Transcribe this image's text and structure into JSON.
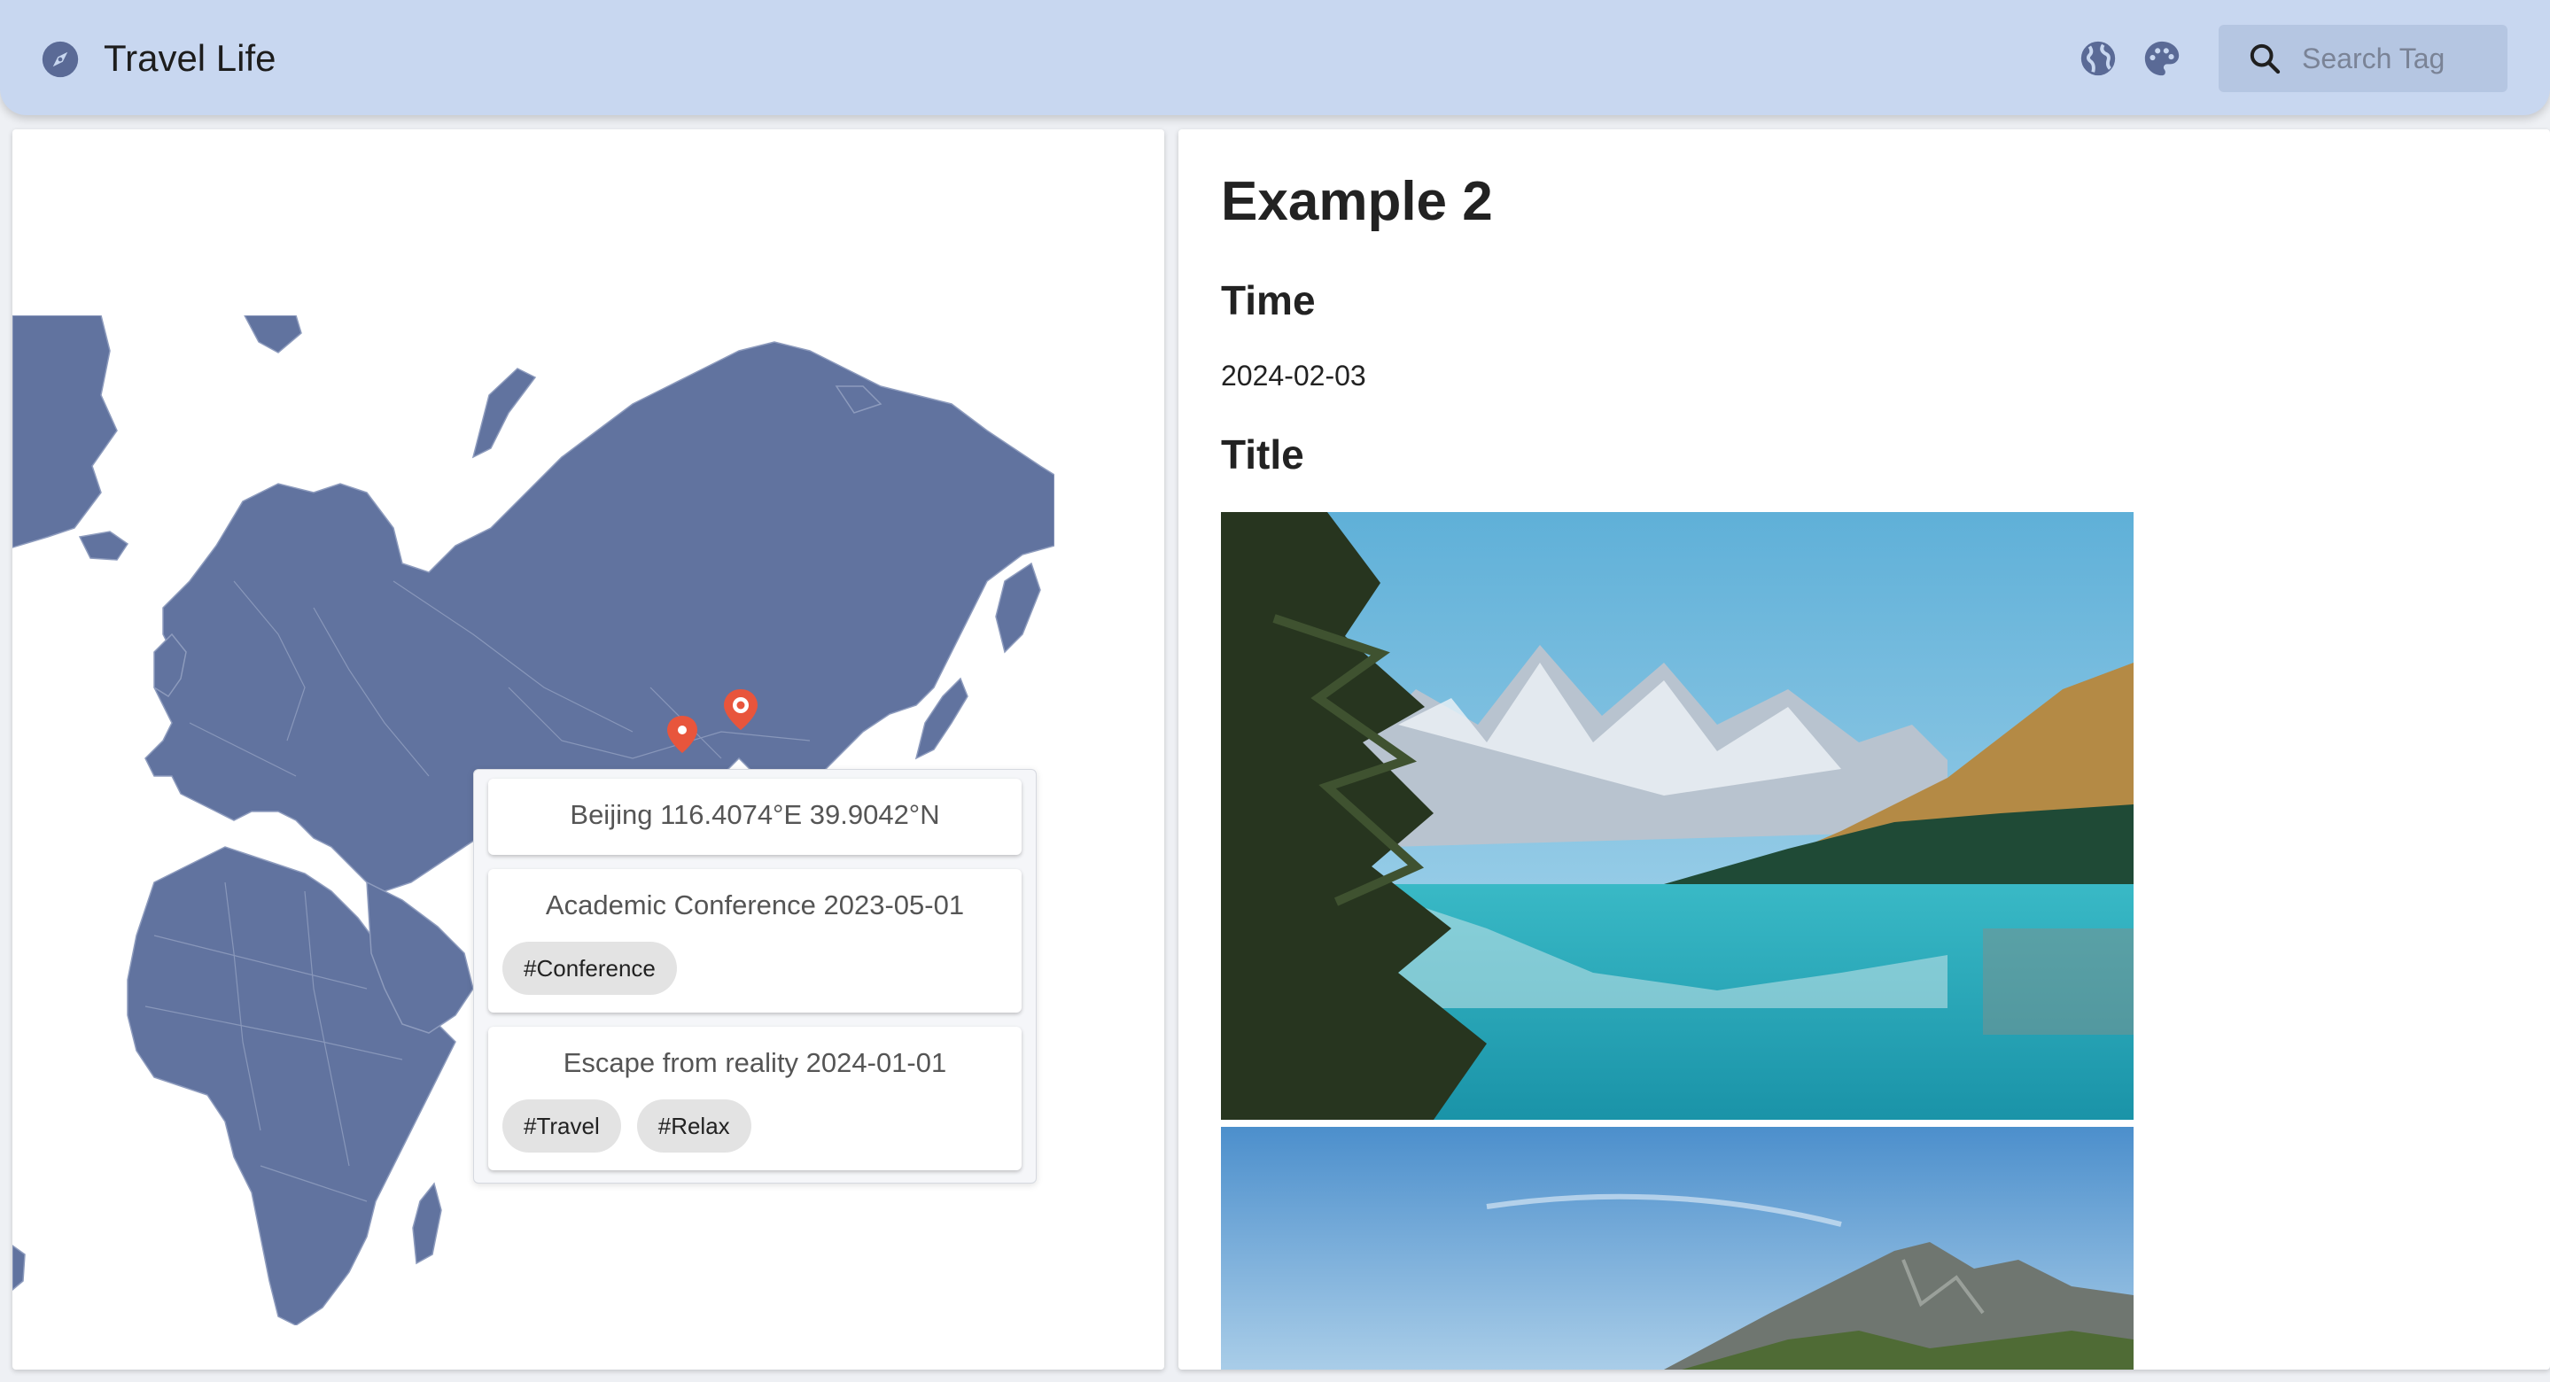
{
  "app": {
    "title": "Travel Life",
    "brand_icon": "compass-icon",
    "actions": [
      {
        "icon": "globe-icon"
      },
      {
        "icon": "palette-icon"
      }
    ],
    "search": {
      "placeholder": "Search Tag",
      "value": "",
      "icon": "search-icon"
    }
  },
  "map": {
    "land_color": "#61739f",
    "marker_color": "#e8553c",
    "markers": [
      {
        "type": "pin-filled"
      },
      {
        "type": "pin-outline"
      }
    ],
    "popup": {
      "location": "Beijing 116.4074°E 39.9042°N",
      "events": [
        {
          "title": "Academic Conference 2023-05-01",
          "tags": [
            "#Conference"
          ]
        },
        {
          "title": "Escape from reality 2024-01-01",
          "tags": [
            "#Travel",
            "#Relax"
          ]
        }
      ]
    }
  },
  "detail": {
    "title": "Example 2",
    "sections": [
      {
        "heading": "Time",
        "value": "2024-02-03"
      },
      {
        "heading": "Title"
      }
    ],
    "photos": [
      {
        "subject": "mountain lake with pine trees"
      },
      {
        "subject": "rocky mountain peak under blue sky"
      }
    ]
  },
  "colors": {
    "appbar": "#c8d7f0",
    "search_bg": "#b5c6e2"
  }
}
